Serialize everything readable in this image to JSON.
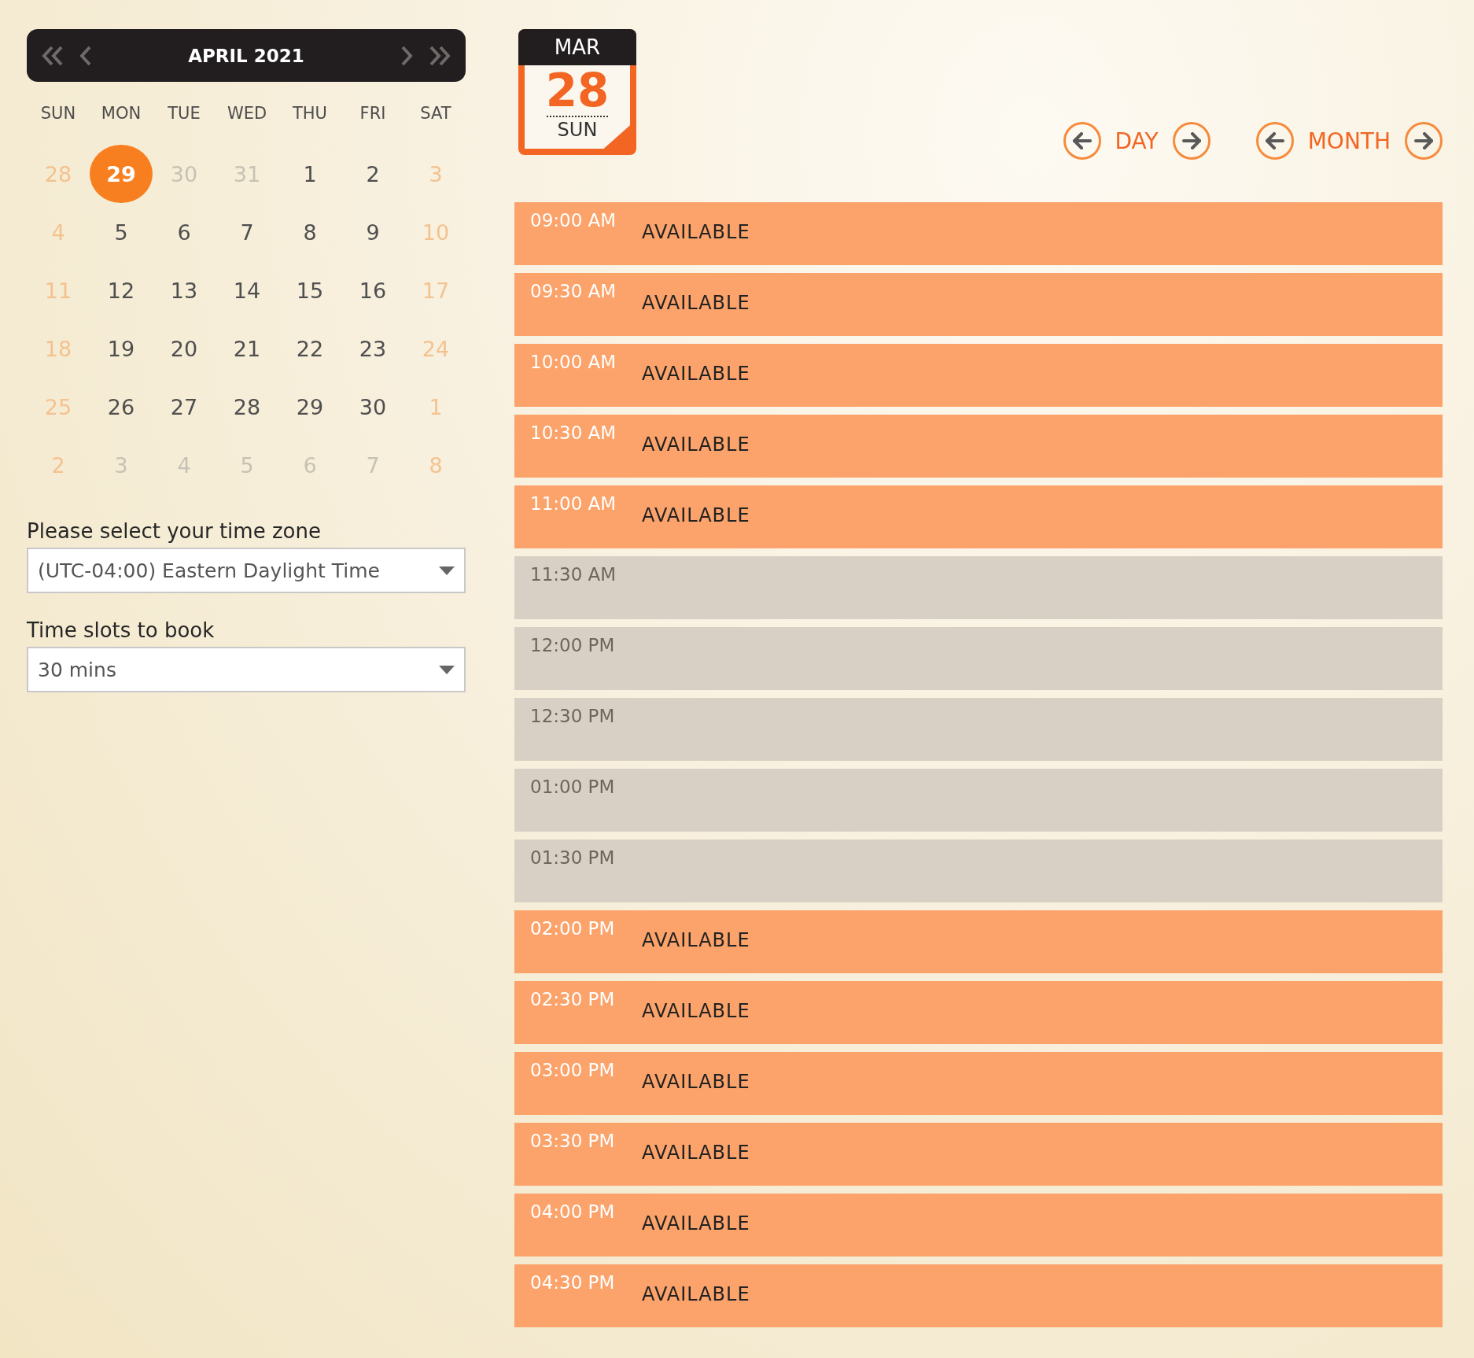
{
  "calendar": {
    "title": "APRIL 2021",
    "weekdays": [
      "SUN",
      "MON",
      "TUE",
      "WED",
      "THU",
      "FRI",
      "SAT"
    ],
    "weeks": [
      [
        {
          "label": "28",
          "kind": "weekend",
          "selected": false
        },
        {
          "label": "29",
          "kind": "outside",
          "selected": true
        },
        {
          "label": "30",
          "kind": "outside",
          "selected": false
        },
        {
          "label": "31",
          "kind": "outside",
          "selected": false
        },
        {
          "label": "1",
          "kind": "current",
          "selected": false
        },
        {
          "label": "2",
          "kind": "current",
          "selected": false
        },
        {
          "label": "3",
          "kind": "weekend",
          "selected": false
        }
      ],
      [
        {
          "label": "4",
          "kind": "weekend",
          "selected": false
        },
        {
          "label": "5",
          "kind": "current",
          "selected": false
        },
        {
          "label": "6",
          "kind": "current",
          "selected": false
        },
        {
          "label": "7",
          "kind": "current",
          "selected": false
        },
        {
          "label": "8",
          "kind": "current",
          "selected": false
        },
        {
          "label": "9",
          "kind": "current",
          "selected": false
        },
        {
          "label": "10",
          "kind": "weekend",
          "selected": false
        }
      ],
      [
        {
          "label": "11",
          "kind": "weekend",
          "selected": false
        },
        {
          "label": "12",
          "kind": "current",
          "selected": false
        },
        {
          "label": "13",
          "kind": "current",
          "selected": false
        },
        {
          "label": "14",
          "kind": "current",
          "selected": false
        },
        {
          "label": "15",
          "kind": "current",
          "selected": false
        },
        {
          "label": "16",
          "kind": "current",
          "selected": false
        },
        {
          "label": "17",
          "kind": "weekend",
          "selected": false
        }
      ],
      [
        {
          "label": "18",
          "kind": "weekend",
          "selected": false
        },
        {
          "label": "19",
          "kind": "current",
          "selected": false
        },
        {
          "label": "20",
          "kind": "current",
          "selected": false
        },
        {
          "label": "21",
          "kind": "current",
          "selected": false
        },
        {
          "label": "22",
          "kind": "current",
          "selected": false
        },
        {
          "label": "23",
          "kind": "current",
          "selected": false
        },
        {
          "label": "24",
          "kind": "weekend",
          "selected": false
        }
      ],
      [
        {
          "label": "25",
          "kind": "weekend",
          "selected": false
        },
        {
          "label": "26",
          "kind": "current",
          "selected": false
        },
        {
          "label": "27",
          "kind": "current",
          "selected": false
        },
        {
          "label": "28",
          "kind": "current",
          "selected": false
        },
        {
          "label": "29",
          "kind": "current",
          "selected": false
        },
        {
          "label": "30",
          "kind": "current",
          "selected": false
        },
        {
          "label": "1",
          "kind": "weekend",
          "selected": false
        }
      ],
      [
        {
          "label": "2",
          "kind": "weekend",
          "selected": false
        },
        {
          "label": "3",
          "kind": "outside",
          "selected": false
        },
        {
          "label": "4",
          "kind": "outside",
          "selected": false
        },
        {
          "label": "5",
          "kind": "outside",
          "selected": false
        },
        {
          "label": "6",
          "kind": "outside",
          "selected": false
        },
        {
          "label": "7",
          "kind": "outside",
          "selected": false
        },
        {
          "label": "8",
          "kind": "weekend",
          "selected": false
        }
      ]
    ]
  },
  "timezone": {
    "label": "Please select your time zone",
    "value": "(UTC-04:00) Eastern Daylight Time"
  },
  "slot_length": {
    "label": "Time slots to book",
    "value": "30 mins"
  },
  "date_badge": {
    "month": "MAR",
    "day": "28",
    "weekday": "SUN"
  },
  "navigation": [
    {
      "label": "DAY"
    },
    {
      "label": "MONTH"
    }
  ],
  "slots": [
    {
      "time": "09:00 AM",
      "available": true,
      "status": "AVAILABLE"
    },
    {
      "time": "09:30 AM",
      "available": true,
      "status": "AVAILABLE"
    },
    {
      "time": "10:00 AM",
      "available": true,
      "status": "AVAILABLE"
    },
    {
      "time": "10:30 AM",
      "available": true,
      "status": "AVAILABLE"
    },
    {
      "time": "11:00 AM",
      "available": true,
      "status": "AVAILABLE"
    },
    {
      "time": "11:30 AM",
      "available": false
    },
    {
      "time": "12:00 PM",
      "available": false
    },
    {
      "time": "12:30 PM",
      "available": false
    },
    {
      "time": "01:00 PM",
      "available": false
    },
    {
      "time": "01:30 PM",
      "available": false
    },
    {
      "time": "02:00 PM",
      "available": true,
      "status": "AVAILABLE"
    },
    {
      "time": "02:30 PM",
      "available": true,
      "status": "AVAILABLE"
    },
    {
      "time": "03:00 PM",
      "available": true,
      "status": "AVAILABLE"
    },
    {
      "time": "03:30 PM",
      "available": true,
      "status": "AVAILABLE"
    },
    {
      "time": "04:00 PM",
      "available": true,
      "status": "AVAILABLE"
    },
    {
      "time": "04:30 PM",
      "available": true,
      "status": "AVAILABLE"
    }
  ]
}
